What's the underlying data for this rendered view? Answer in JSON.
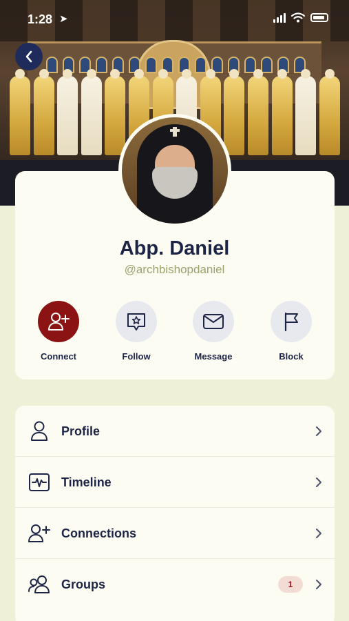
{
  "status_bar": {
    "time": "1:28",
    "location_glyph": "➤"
  },
  "profile": {
    "name": "Abp. Daniel",
    "handle": "@archbishopdaniel"
  },
  "actions": [
    {
      "label": "Connect",
      "icon": "add-user-icon",
      "primary": true
    },
    {
      "label": "Follow",
      "icon": "star-chat-icon",
      "primary": false
    },
    {
      "label": "Message",
      "icon": "envelope-icon",
      "primary": false
    },
    {
      "label": "Block",
      "icon": "flag-icon",
      "primary": false
    }
  ],
  "menu": [
    {
      "label": "Profile",
      "icon": "user-icon"
    },
    {
      "label": "Timeline",
      "icon": "activity-icon"
    },
    {
      "label": "Connections",
      "icon": "add-user-icon"
    },
    {
      "label": "Groups",
      "icon": "users-icon",
      "badge": "1"
    }
  ],
  "colors": {
    "background": "#eef0d8",
    "card": "#fdfcf3",
    "primary": "#8b1313",
    "text": "#1d2547",
    "handle": "#9aa26d"
  }
}
